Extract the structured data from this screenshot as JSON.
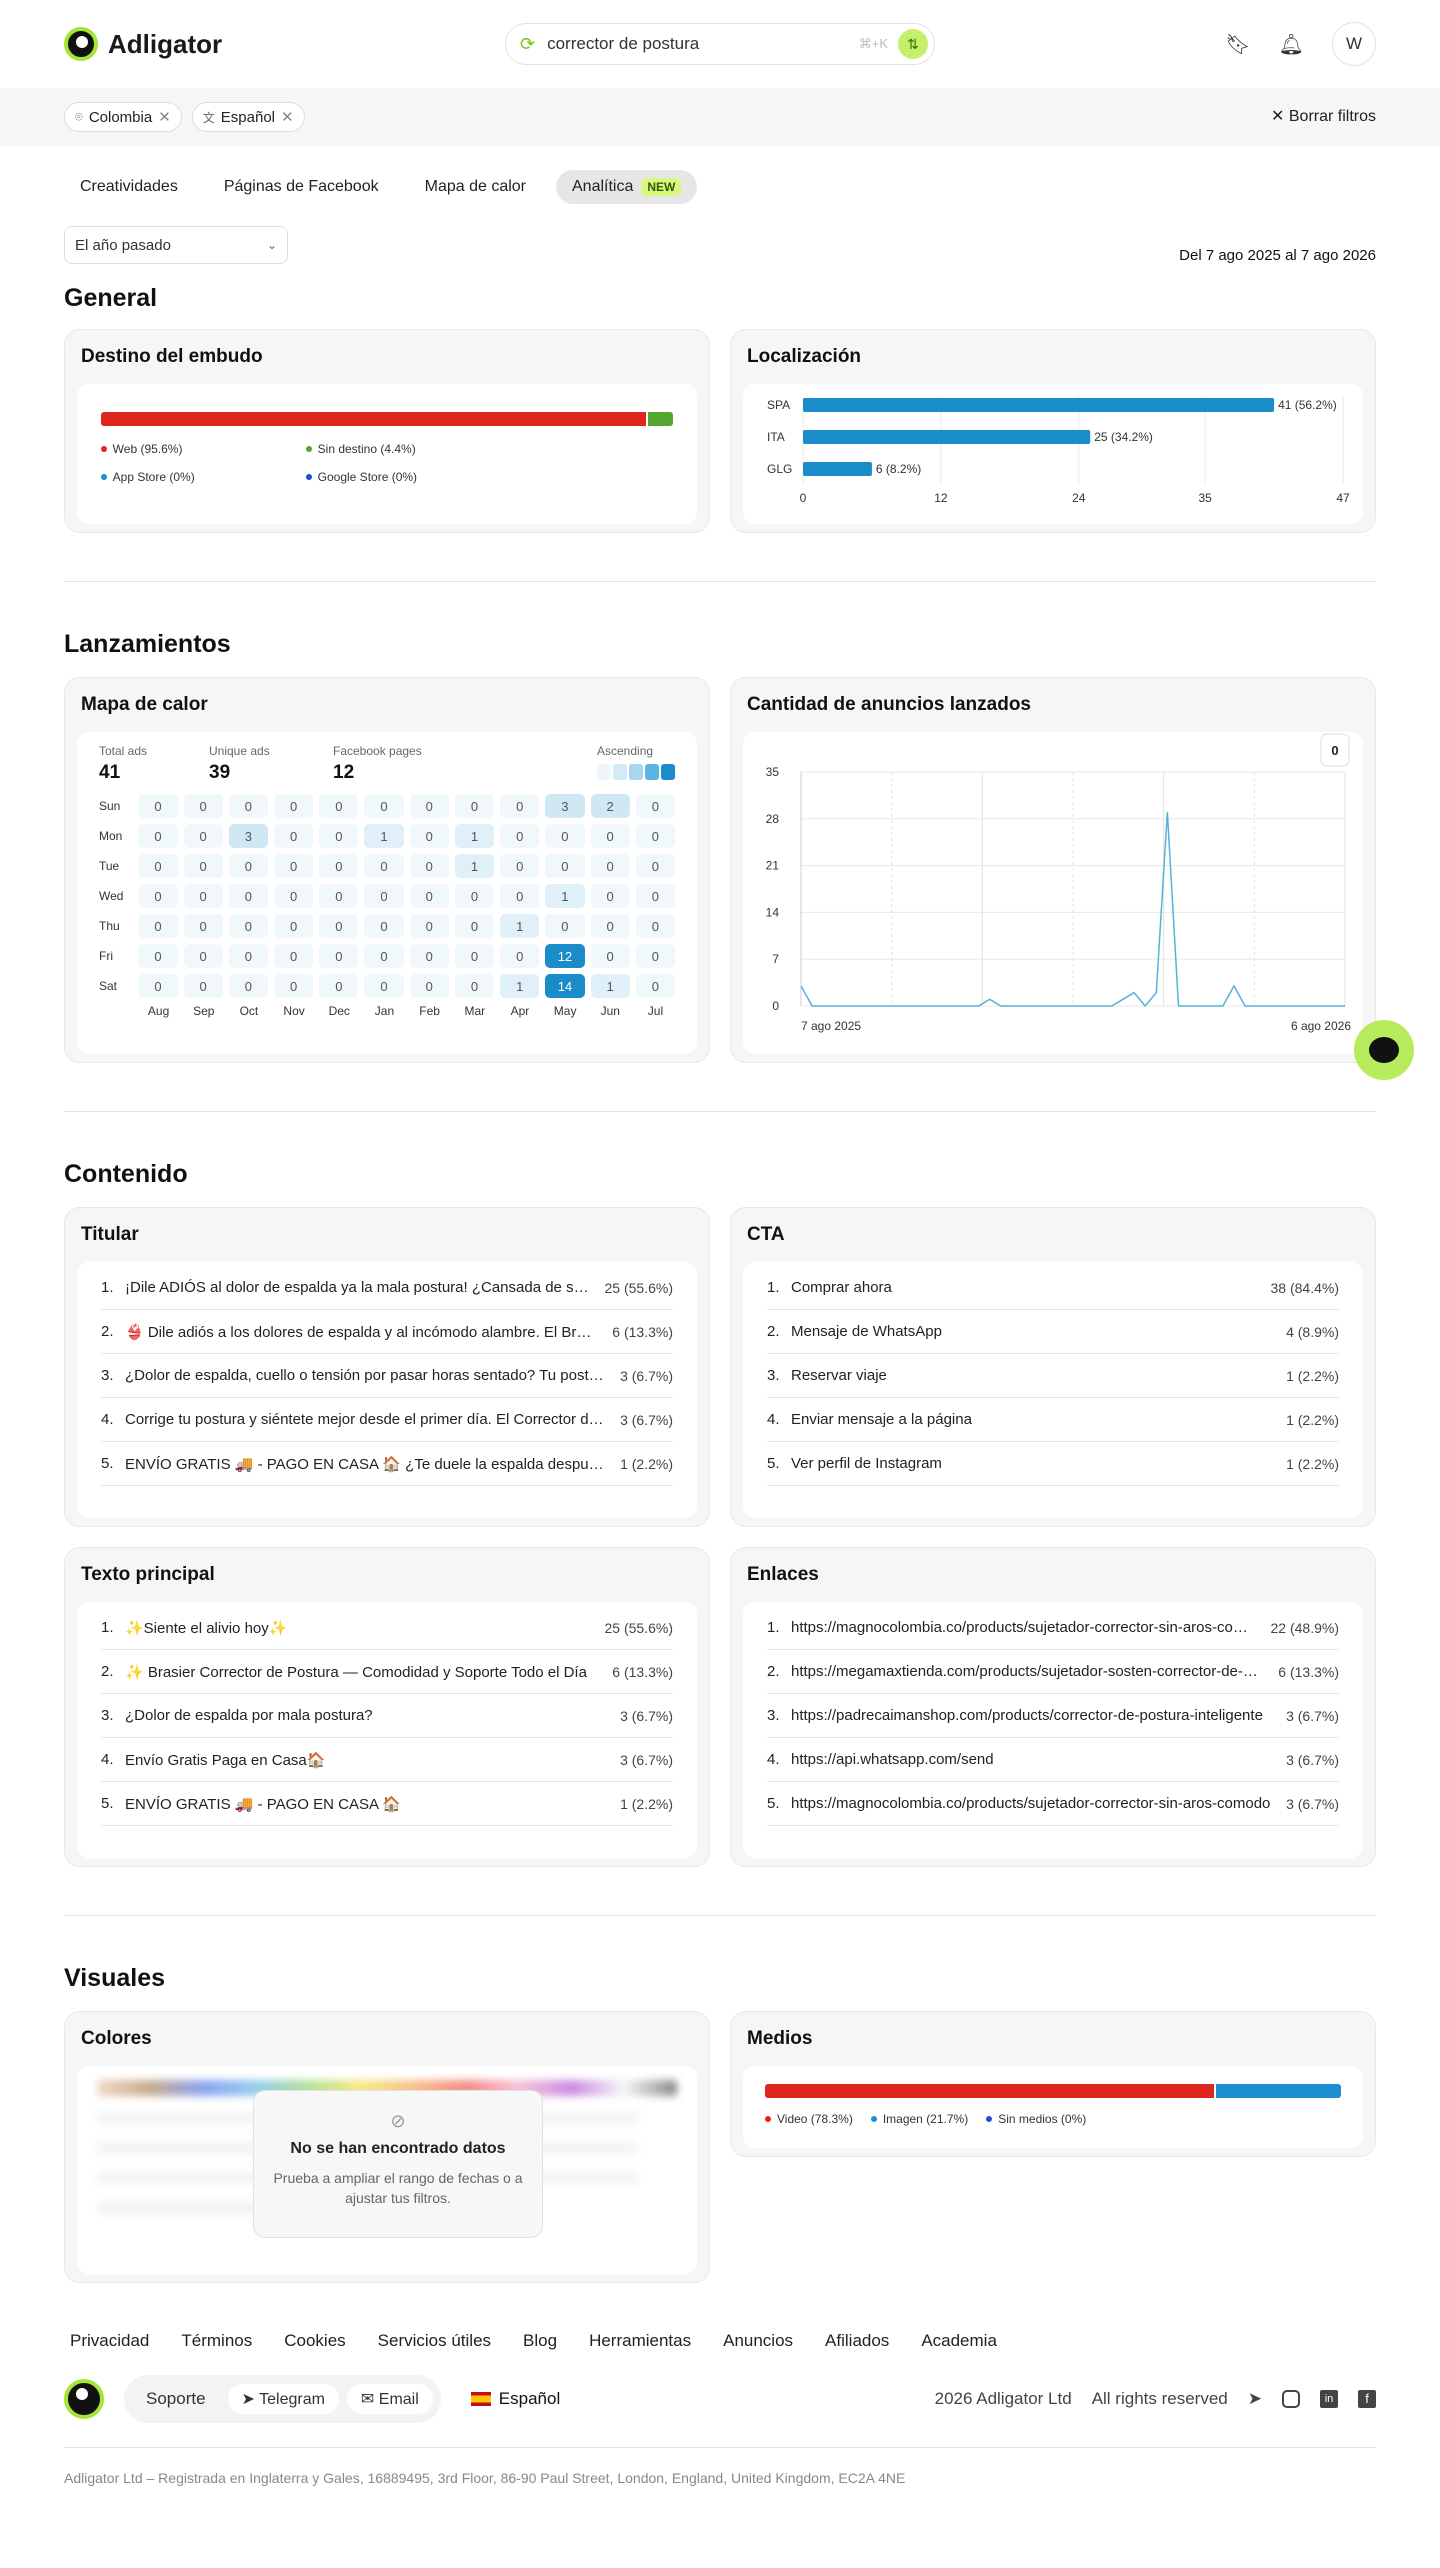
{
  "app": {
    "name": "Adligator"
  },
  "search": {
    "value": "corrector de postura",
    "shortcut": "⌘+K"
  },
  "header": {
    "avatar": "W"
  },
  "filters": {
    "chips": [
      "Colombia",
      "Español"
    ],
    "clear": "Borrar filtros"
  },
  "tabs": [
    {
      "label": "Creatividades"
    },
    {
      "label": "Páginas de Facebook"
    },
    {
      "label": "Mapa de calor"
    },
    {
      "label": "Analítica",
      "badge": "NEW"
    }
  ],
  "period": {
    "select": "El año pasado",
    "range": "Del 7 ago 2025 al 7 ago 2026"
  },
  "sections": {
    "general": "General",
    "launches": "Lanzamientos",
    "content": "Contenido",
    "visuals": "Visuales"
  },
  "funnel": {
    "title": "Destino del embudo",
    "segments": [
      {
        "label": "Web (95.6%)",
        "value": 95.6,
        "color": "#e0271f"
      },
      {
        "label": "Sin destino (4.4%)",
        "value": 4.4,
        "color": "#52a82f"
      },
      {
        "label": "App Store (0%)",
        "value": 0,
        "color": "#1b8ed0"
      },
      {
        "label": "Google Store (0%)",
        "value": 0,
        "color": "#1f4fd6"
      }
    ]
  },
  "location": {
    "title": "Localización",
    "bars": [
      {
        "label": "SPA",
        "value": 41,
        "text": "41 (56.2%)"
      },
      {
        "label": "ITA",
        "value": 25,
        "text": "25 (34.2%)"
      },
      {
        "label": "GLG",
        "value": 6,
        "text": "6 (8.2%)"
      }
    ],
    "ticks": [
      "0",
      "12",
      "24",
      "35",
      "47"
    ],
    "max": 47
  },
  "heatmap": {
    "title": "Mapa de calor",
    "stats": [
      {
        "label": "Total ads",
        "value": "41"
      },
      {
        "label": "Unique ads",
        "value": "39"
      },
      {
        "label": "Facebook pages",
        "value": "12"
      }
    ],
    "scale_label": "Ascending",
    "rows": [
      "Sun",
      "Mon",
      "Tue",
      "Wed",
      "Thu",
      "Fri",
      "Sat"
    ],
    "cols": [
      "Aug",
      "Sep",
      "Oct",
      "Nov",
      "Dec",
      "Jan",
      "Feb",
      "Mar",
      "Apr",
      "May",
      "Jun",
      "Jul"
    ],
    "values": [
      [
        0,
        0,
        0,
        0,
        0,
        0,
        0,
        0,
        0,
        3,
        2,
        0
      ],
      [
        0,
        0,
        3,
        0,
        0,
        1,
        0,
        1,
        0,
        0,
        0,
        0
      ],
      [
        0,
        0,
        0,
        0,
        0,
        0,
        0,
        1,
        0,
        0,
        0,
        0
      ],
      [
        0,
        0,
        0,
        0,
        0,
        0,
        0,
        0,
        0,
        1,
        0,
        0
      ],
      [
        0,
        0,
        0,
        0,
        0,
        0,
        0,
        0,
        1,
        0,
        0,
        0
      ],
      [
        0,
        0,
        0,
        0,
        0,
        0,
        0,
        0,
        0,
        12,
        0,
        0
      ],
      [
        0,
        0,
        0,
        0,
        0,
        0,
        0,
        0,
        1,
        14,
        1,
        0
      ]
    ]
  },
  "chart_data": {
    "type": "line",
    "title": "Cantidad de anuncios lanzados",
    "badge": "0",
    "x_start": "7 ago 2025",
    "x_end": "6 ago 2026",
    "yticks": [
      0,
      7,
      14,
      21,
      28,
      35
    ],
    "ylim": [
      0,
      35
    ],
    "values": [
      3,
      0,
      0,
      0,
      0,
      0,
      0,
      0,
      0,
      0,
      0,
      0,
      0,
      0,
      0,
      0,
      0,
      1,
      0,
      0,
      0,
      0,
      0,
      0,
      0,
      0,
      0,
      0,
      0,
      1,
      2,
      0,
      2,
      29,
      0,
      0,
      0,
      0,
      0,
      3,
      0,
      0,
      0,
      0,
      0,
      0,
      0,
      0,
      0,
      0
    ]
  },
  "titular": {
    "title": "Titular",
    "items": [
      {
        "n": "1.",
        "text": "¡Dile ADIÓS al dolor de espalda ya la mala postura! ¿Cansada de sentir tensión en tu espalda?",
        "value": "25 (55.6%)"
      },
      {
        "n": "2.",
        "text": "👙 Dile adiós a los dolores de espalda y al incómodo alambre. El Brasier Corrector",
        "value": "6 (13.3%)"
      },
      {
        "n": "3.",
        "text": "¿Dolor de espalda, cuello o tensión por pasar horas sentado? Tu postura importa",
        "value": "3 (6.7%)"
      },
      {
        "n": "4.",
        "text": "Corrige tu postura y siéntete mejor desde el primer día. El Corrector de Postura",
        "value": "3 (6.7%)"
      },
      {
        "n": "5.",
        "text": "ENVÍO GRATIS 🚚 - PAGO EN CASA 🏠 ¿Te duele la espalda después de un largo día?",
        "value": "1 (2.2%)"
      }
    ]
  },
  "cta": {
    "title": "CTA",
    "items": [
      {
        "n": "1.",
        "text": "Comprar ahora",
        "value": "38 (84.4%)"
      },
      {
        "n": "2.",
        "text": "Mensaje de WhatsApp",
        "value": "4 (8.9%)"
      },
      {
        "n": "3.",
        "text": "Reservar viaje",
        "value": "1 (2.2%)"
      },
      {
        "n": "4.",
        "text": "Enviar mensaje a la página",
        "value": "1 (2.2%)"
      },
      {
        "n": "5.",
        "text": "Ver perfil de Instagram",
        "value": "1 (2.2%)"
      }
    ]
  },
  "texto": {
    "title": "Texto principal",
    "items": [
      {
        "n": "1.",
        "text": "✨Siente el alivio hoy✨",
        "value": "25 (55.6%)"
      },
      {
        "n": "2.",
        "text": "✨ Brasier Corrector de Postura — Comodidad y Soporte Todo el Día",
        "value": "6 (13.3%)"
      },
      {
        "n": "3.",
        "text": "¿Dolor de espalda por mala postura?",
        "value": "3 (6.7%)"
      },
      {
        "n": "4.",
        "text": "Envío Gratis Paga en Casa🏠",
        "value": "3 (6.7%)"
      },
      {
        "n": "5.",
        "text": "ENVÍO GRATIS 🚚 - PAGO EN CASA 🏠",
        "value": "1 (2.2%)"
      }
    ]
  },
  "enlaces": {
    "title": "Enlaces",
    "items": [
      {
        "n": "1.",
        "text": "https://magnocolombia.co/products/sujetador-corrector-sin-aros-comodo",
        "value": "22 (48.9%)"
      },
      {
        "n": "2.",
        "text": "https://megamaxtienda.com/products/sujetador-sosten-corrector-de-postura",
        "value": "6 (13.3%)"
      },
      {
        "n": "3.",
        "text": "https://padrecaimanshop.com/products/corrector-de-postura-inteligente",
        "value": "3 (6.7%)"
      },
      {
        "n": "4.",
        "text": "https://api.whatsapp.com/send",
        "value": "3 (6.7%)"
      },
      {
        "n": "5.",
        "text": "https://magnocolombia.co/products/sujetador-corrector-sin-aros-comodo",
        "value": "3 (6.7%)"
      }
    ]
  },
  "colores": {
    "title": "Colores",
    "empty_title": "No se han encontrado datos",
    "empty_text": "Prueba a ampliar el rango de fechas o a ajustar tus filtros."
  },
  "medios": {
    "title": "Medios",
    "segments": [
      {
        "label": "Video (78.3%)",
        "value": 78.3,
        "color": "#e0271f"
      },
      {
        "label": "Imagen (21.7%)",
        "value": 21.7,
        "color": "#1b8ed0"
      },
      {
        "label": "Sin medios (0%)",
        "value": 0,
        "color": "#1f4fd6"
      }
    ]
  },
  "footer": {
    "links": [
      "Privacidad",
      "Términos",
      "Cookies",
      "Servicios útiles",
      "Blog",
      "Herramientas",
      "Anuncios",
      "Afiliados",
      "Academia"
    ],
    "support": "Soporte",
    "telegram": "Telegram",
    "email": "Email",
    "language": "Español",
    "copyright": "2026 Adligator Ltd",
    "rights": "All rights reserved",
    "legal": "Adligator Ltd – Registrada en Inglaterra y Gales, 16889495, 3rd Floor, 86-90 Paul Street, London, England, United Kingdom, EC2A 4NE"
  }
}
